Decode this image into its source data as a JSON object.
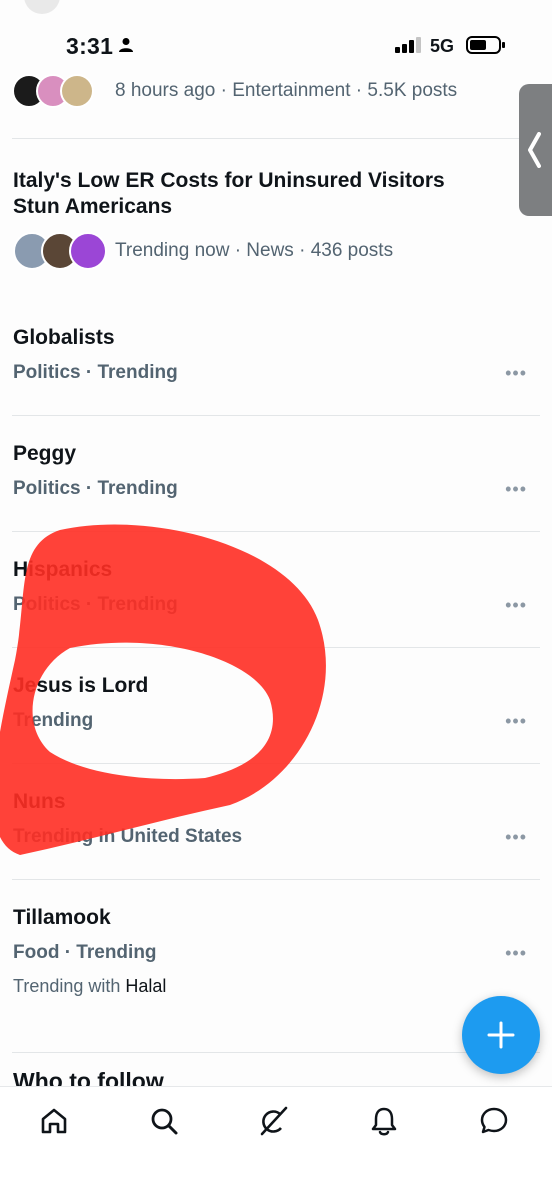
{
  "status_bar": {
    "time": "3:31",
    "network": "5G"
  },
  "feed": {
    "partial_item": {
      "meta": "8 hours ago · Entertainment · 5.5K posts"
    },
    "news_item": {
      "title": "Italy's Low ER Costs for Uninsured Visitors Stun Americans",
      "meta": "Trending now · News · 436 posts"
    },
    "trends": [
      {
        "title": "Globalists",
        "subtitle": "Politics · Trending"
      },
      {
        "title": "Peggy",
        "subtitle": "Politics · Trending"
      },
      {
        "title": "Hispanics",
        "subtitle": "Politics · Trending"
      },
      {
        "title": "Jesus is Lord",
        "subtitle": "Trending"
      },
      {
        "title": "Nuns",
        "subtitle": "Trending in United States"
      },
      {
        "title": "Tillamook",
        "subtitle": "Food · Trending",
        "trending_with_prefix": "Trending with",
        "trending_with_term": "Halal"
      }
    ],
    "more_glyph": "•••",
    "who_to_follow": "Who to follow"
  },
  "tab_bar": {
    "icons": [
      "home-icon",
      "search-icon",
      "grok-icon",
      "notifications-icon",
      "messages-icon"
    ]
  },
  "colors": {
    "accent": "#1d9bf0",
    "muted": "#536471",
    "annotation": "#ff2d24"
  }
}
